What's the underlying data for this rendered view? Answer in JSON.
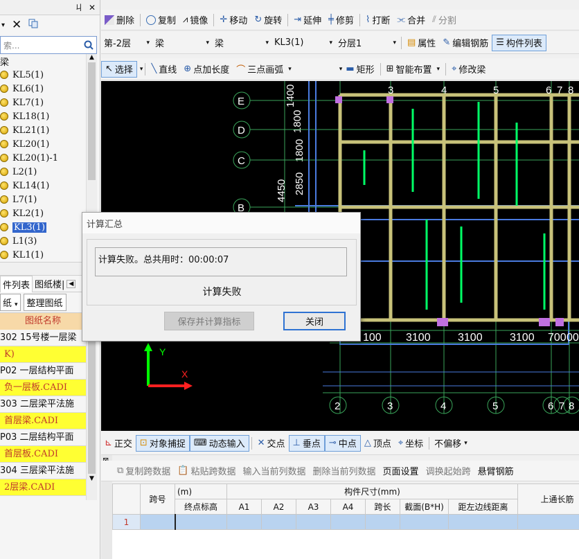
{
  "left_panel": {
    "pin_glyph": "ㄐ",
    "close_glyph": "✕",
    "search_placeholder": "索...",
    "tree_header": "梁",
    "tree_items": [
      {
        "label": "KL5(1)",
        "selected": false
      },
      {
        "label": "KL6(1)",
        "selected": false
      },
      {
        "label": "KL7(1)",
        "selected": false
      },
      {
        "label": "KL18(1)",
        "selected": false
      },
      {
        "label": "KL21(1)",
        "selected": false
      },
      {
        "label": "KL20(1)",
        "selected": false
      },
      {
        "label": "KL20(1)-1",
        "selected": false
      },
      {
        "label": "L2(1)",
        "selected": false
      },
      {
        "label": "KL14(1)",
        "selected": false
      },
      {
        "label": "L7(1)",
        "selected": false
      },
      {
        "label": "KL2(1)",
        "selected": false
      },
      {
        "label": "KL3(1)",
        "selected": true
      },
      {
        "label": "L1(3)",
        "selected": false
      },
      {
        "label": "KL1(1)",
        "selected": false
      }
    ],
    "tabs": [
      "件列表",
      "图纸楼|"
    ],
    "drawing_combo": "纸",
    "organize_button": "整理图纸",
    "drawing_col_header": "图纸名称",
    "drawings": [
      {
        "text": "302 15号楼一层梁",
        "highlight": false
      },
      {
        "text": "K)",
        "highlight": true
      },
      {
        "text": "P02 一层结构平面",
        "highlight": false
      },
      {
        "text": "负一层板.CADI",
        "highlight": true
      },
      {
        "text": "303 二层梁平法施",
        "highlight": false
      },
      {
        "text": "首层梁.CADI",
        "highlight": true
      },
      {
        "text": "P03 二层结构平面",
        "highlight": false
      },
      {
        "text": "首层板.CADI",
        "highlight": true
      },
      {
        "text": "304 三层梁平法施",
        "highlight": false
      },
      {
        "text": "2层梁.CADI",
        "highlight": true
      }
    ]
  },
  "toolbar1": {
    "items": [
      "删除",
      "复制",
      "镜像",
      "移动",
      "旋转",
      "延伸",
      "修剪",
      "打断",
      "合并",
      "分割"
    ]
  },
  "toolbar2": {
    "floor": "第-2层",
    "category": "梁",
    "type": "梁",
    "component": "KL3(1)",
    "layer": "分层1",
    "properties": "属性",
    "edit_rebar": "编辑钢筋",
    "component_list": "构件列表"
  },
  "toolbar3": {
    "select": "选择",
    "line": "直线",
    "point_extend": "点加长度",
    "three_point_arc": "三点画弧",
    "rectangle": "矩形",
    "smart_layout": "智能布置",
    "modify_beam": "修改梁"
  },
  "canvas": {
    "axis_rows": [
      "E",
      "D",
      "C",
      "B"
    ],
    "axis_cols_top": [
      "3",
      "4",
      "5",
      "6",
      "7",
      "8"
    ],
    "axis_cols_bottom": [
      "2",
      "3",
      "4",
      "5",
      "6",
      "7",
      "8"
    ],
    "vertical_dims": [
      "1400",
      "1800",
      "1800",
      "2850",
      "4450"
    ],
    "horizontal_dims": [
      "100",
      "3100",
      "3100",
      "3100",
      "700",
      "00"
    ],
    "ucs_y": "Y",
    "ucs_x": "X",
    "colors": {
      "background": "#000000",
      "beam": "#c8c27a",
      "wall": "#4a9bd8",
      "axis": "#3aa55a",
      "rebar": "#00ff66",
      "text": "#ffffff"
    }
  },
  "dialog": {
    "title": "计算汇总",
    "message": "计算失败。总共用时：00:00:07",
    "status": "计算失败",
    "save_button": "保存并计算指标",
    "close_button": "关闭"
  },
  "snapbar": {
    "ortho": "正交",
    "object_snap": "对象捕捉",
    "dynamic_input": "动态输入",
    "intersection": "交点",
    "perpendicular": "垂点",
    "midpoint": "中点",
    "vertex": "顶点",
    "coordinate": "坐标",
    "offset": "不偏移"
  },
  "tablebar": {
    "items": [
      "复制跨数据",
      "粘贴跨数据",
      "输入当前列数据",
      "删除当前列数据",
      "页面设置",
      "调换起始跨",
      "悬臂钢筋"
    ]
  },
  "grid": {
    "header_span": "跨号",
    "header_unit": "(m)",
    "header_end_elev": "终点标高",
    "header_size": "构件尺寸(mm)",
    "cols": [
      "A1",
      "A2",
      "A3",
      "A4",
      "跨长",
      "截面(B*H)",
      "距左边线距离"
    ],
    "header_top_long": "上通长筋",
    "row_no": "1"
  }
}
